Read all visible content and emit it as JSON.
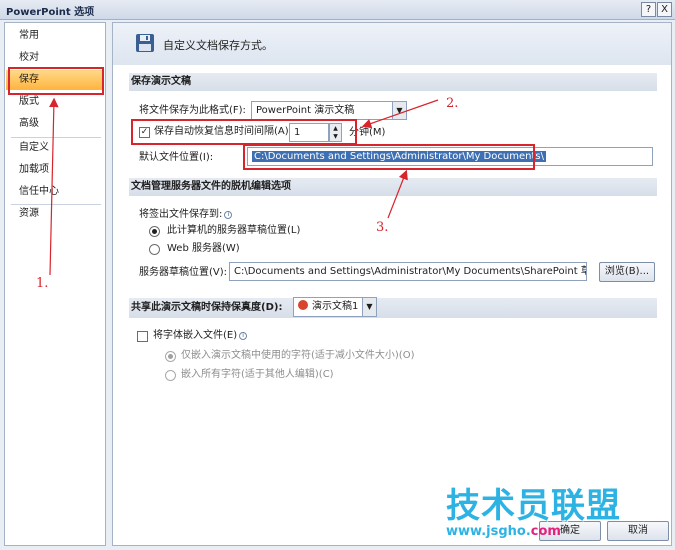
{
  "window": {
    "title": "PowerPoint 选项",
    "help_label": "?",
    "close_label": "X"
  },
  "sidebar": {
    "items": [
      {
        "label": "常用"
      },
      {
        "label": "校对"
      },
      {
        "label": "保存",
        "selected": true
      },
      {
        "label": "版式"
      },
      {
        "label": "高级"
      },
      {
        "label": "自定义"
      },
      {
        "label": "加载项"
      },
      {
        "label": "信任中心"
      },
      {
        "label": "资源"
      }
    ]
  },
  "main": {
    "header_text": "自定义文档保存方式。",
    "save_section": {
      "title": "保存演示文稿",
      "format_label": "将文件保存为此格式(F):",
      "format_value": "PowerPoint 演示文稿",
      "autorecover_label": "保存自动恢复信息时间间隔(A)",
      "autorecover_checked": true,
      "autorecover_value": "1",
      "minutes_label": "分钟(M)",
      "default_location_label": "默认文件位置(I):",
      "default_location_value": "C:\\Documents and Settings\\Administrator\\My Documents\\"
    },
    "offline_section": {
      "title": "文档管理服务器文件的脱机编辑选项",
      "checkout_label": "将签出文件保存到:",
      "radio_local": "此计算机的服务器草稿位置(L)",
      "radio_web": "Web 服务器(W)",
      "drafts_label": "服务器草稿位置(V):",
      "drafts_value": "C:\\Documents and Settings\\Administrator\\My Documents\\SharePoint 草稿\\",
      "browse_label": "浏览(B)..."
    },
    "fidelity_section": {
      "title": "共享此演示文稿时保持保真度(D):",
      "presentation_value": "演示文稿1",
      "embed_fonts_label": "将字体嵌入文件(E)",
      "embed_fonts_checked": false,
      "embed_used_only": "仅嵌入演示文稿中使用的字符(适于减小文件大小)(O)",
      "embed_all": "嵌入所有字符(适于其他人编辑)(C)"
    },
    "footer": {
      "ok_label": "确定",
      "cancel_label": "取消"
    }
  },
  "annotations": {
    "step1": "1.",
    "step2": "2.",
    "step3": "3.",
    "color": "#d8242c"
  },
  "watermark": {
    "brand": "技术员联盟",
    "url_prefix": "www.jsgho.",
    "url_domain": "com"
  },
  "colors": {
    "selected_nav": "#ffb43e",
    "section_header": "#d6dee9",
    "annotation": "#d8242c",
    "watermark": "#2db3e3"
  }
}
